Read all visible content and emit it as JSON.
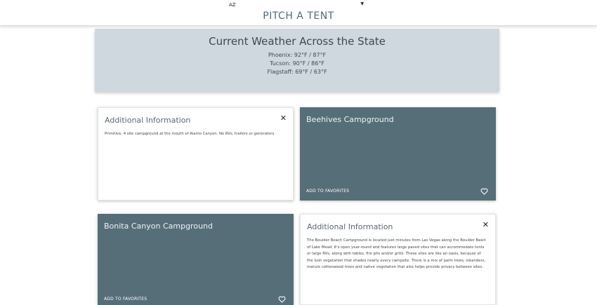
{
  "state_select": {
    "value": "AZ"
  },
  "header": {
    "title": "PITCH A TENT"
  },
  "weather": {
    "title": "Current Weather Across the State",
    "lines": [
      "Phoenix: 92°F / 87°F",
      "Tucson: 90°F / 86°F",
      "Flagstaff: 69°F / 63°F"
    ]
  },
  "cards": {
    "alamo_info": {
      "title": "Additional Information",
      "text": "Primitive, 4 site campground at the mouth of Alamo Canyon. No RVs, trailers or generators."
    },
    "beehives": {
      "title": "Beehives Campground",
      "fav_label": "ADD TO FAVORITES"
    },
    "bonita": {
      "title": "Bonita Canyon Campground",
      "fav_label": "ADD TO FAVORITES"
    },
    "boulder_info": {
      "title": "Additional Information",
      "text": "The Boulder Beach Campground is located just minutes from Las Vegas along the Boulder Basin of Lake Mead. It's open year-round and features large paved sites that can accommodate tents or large RVs, along with tables, fire pits and/or grills. These sites are like an oasis, because of the lush vegetation that shades nearly every campsite. There is a mix of palm trees, oleanders, mature cottonwood trees and native vegetation that also helps provide privacy between sites."
    }
  },
  "icons": {
    "close": "close-icon",
    "heart": "heart-outline-icon",
    "dropdown": "caret-down-icon"
  },
  "colors": {
    "accent": "#4e6b78",
    "card_dark": "#566e78",
    "weather_bg": "#cfd8df"
  }
}
